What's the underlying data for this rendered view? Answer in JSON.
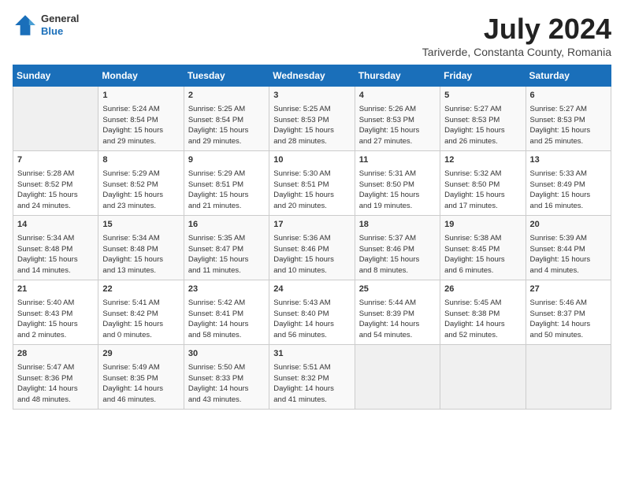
{
  "header": {
    "logo_general": "General",
    "logo_blue": "Blue",
    "month_title": "July 2024",
    "location": "Tariverde, Constanta County, Romania"
  },
  "calendar": {
    "days_of_week": [
      "Sunday",
      "Monday",
      "Tuesday",
      "Wednesday",
      "Thursday",
      "Friday",
      "Saturday"
    ],
    "weeks": [
      [
        {
          "day": "",
          "content": ""
        },
        {
          "day": "1",
          "content": "Sunrise: 5:24 AM\nSunset: 8:54 PM\nDaylight: 15 hours\nand 29 minutes."
        },
        {
          "day": "2",
          "content": "Sunrise: 5:25 AM\nSunset: 8:54 PM\nDaylight: 15 hours\nand 29 minutes."
        },
        {
          "day": "3",
          "content": "Sunrise: 5:25 AM\nSunset: 8:53 PM\nDaylight: 15 hours\nand 28 minutes."
        },
        {
          "day": "4",
          "content": "Sunrise: 5:26 AM\nSunset: 8:53 PM\nDaylight: 15 hours\nand 27 minutes."
        },
        {
          "day": "5",
          "content": "Sunrise: 5:27 AM\nSunset: 8:53 PM\nDaylight: 15 hours\nand 26 minutes."
        },
        {
          "day": "6",
          "content": "Sunrise: 5:27 AM\nSunset: 8:53 PM\nDaylight: 15 hours\nand 25 minutes."
        }
      ],
      [
        {
          "day": "7",
          "content": "Sunrise: 5:28 AM\nSunset: 8:52 PM\nDaylight: 15 hours\nand 24 minutes."
        },
        {
          "day": "8",
          "content": "Sunrise: 5:29 AM\nSunset: 8:52 PM\nDaylight: 15 hours\nand 23 minutes."
        },
        {
          "day": "9",
          "content": "Sunrise: 5:29 AM\nSunset: 8:51 PM\nDaylight: 15 hours\nand 21 minutes."
        },
        {
          "day": "10",
          "content": "Sunrise: 5:30 AM\nSunset: 8:51 PM\nDaylight: 15 hours\nand 20 minutes."
        },
        {
          "day": "11",
          "content": "Sunrise: 5:31 AM\nSunset: 8:50 PM\nDaylight: 15 hours\nand 19 minutes."
        },
        {
          "day": "12",
          "content": "Sunrise: 5:32 AM\nSunset: 8:50 PM\nDaylight: 15 hours\nand 17 minutes."
        },
        {
          "day": "13",
          "content": "Sunrise: 5:33 AM\nSunset: 8:49 PM\nDaylight: 15 hours\nand 16 minutes."
        }
      ],
      [
        {
          "day": "14",
          "content": "Sunrise: 5:34 AM\nSunset: 8:48 PM\nDaylight: 15 hours\nand 14 minutes."
        },
        {
          "day": "15",
          "content": "Sunrise: 5:34 AM\nSunset: 8:48 PM\nDaylight: 15 hours\nand 13 minutes."
        },
        {
          "day": "16",
          "content": "Sunrise: 5:35 AM\nSunset: 8:47 PM\nDaylight: 15 hours\nand 11 minutes."
        },
        {
          "day": "17",
          "content": "Sunrise: 5:36 AM\nSunset: 8:46 PM\nDaylight: 15 hours\nand 10 minutes."
        },
        {
          "day": "18",
          "content": "Sunrise: 5:37 AM\nSunset: 8:46 PM\nDaylight: 15 hours\nand 8 minutes."
        },
        {
          "day": "19",
          "content": "Sunrise: 5:38 AM\nSunset: 8:45 PM\nDaylight: 15 hours\nand 6 minutes."
        },
        {
          "day": "20",
          "content": "Sunrise: 5:39 AM\nSunset: 8:44 PM\nDaylight: 15 hours\nand 4 minutes."
        }
      ],
      [
        {
          "day": "21",
          "content": "Sunrise: 5:40 AM\nSunset: 8:43 PM\nDaylight: 15 hours\nand 2 minutes."
        },
        {
          "day": "22",
          "content": "Sunrise: 5:41 AM\nSunset: 8:42 PM\nDaylight: 15 hours\nand 0 minutes."
        },
        {
          "day": "23",
          "content": "Sunrise: 5:42 AM\nSunset: 8:41 PM\nDaylight: 14 hours\nand 58 minutes."
        },
        {
          "day": "24",
          "content": "Sunrise: 5:43 AM\nSunset: 8:40 PM\nDaylight: 14 hours\nand 56 minutes."
        },
        {
          "day": "25",
          "content": "Sunrise: 5:44 AM\nSunset: 8:39 PM\nDaylight: 14 hours\nand 54 minutes."
        },
        {
          "day": "26",
          "content": "Sunrise: 5:45 AM\nSunset: 8:38 PM\nDaylight: 14 hours\nand 52 minutes."
        },
        {
          "day": "27",
          "content": "Sunrise: 5:46 AM\nSunset: 8:37 PM\nDaylight: 14 hours\nand 50 minutes."
        }
      ],
      [
        {
          "day": "28",
          "content": "Sunrise: 5:47 AM\nSunset: 8:36 PM\nDaylight: 14 hours\nand 48 minutes."
        },
        {
          "day": "29",
          "content": "Sunrise: 5:49 AM\nSunset: 8:35 PM\nDaylight: 14 hours\nand 46 minutes."
        },
        {
          "day": "30",
          "content": "Sunrise: 5:50 AM\nSunset: 8:33 PM\nDaylight: 14 hours\nand 43 minutes."
        },
        {
          "day": "31",
          "content": "Sunrise: 5:51 AM\nSunset: 8:32 PM\nDaylight: 14 hours\nand 41 minutes."
        },
        {
          "day": "",
          "content": ""
        },
        {
          "day": "",
          "content": ""
        },
        {
          "day": "",
          "content": ""
        }
      ]
    ]
  }
}
